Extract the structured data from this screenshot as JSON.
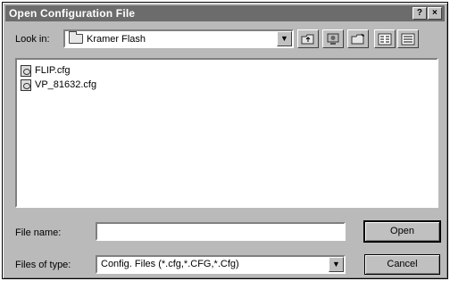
{
  "window": {
    "title": "Open Configuration File",
    "help_label": "?",
    "close_label": "×"
  },
  "lookin": {
    "label": "Look in:",
    "value": "Kramer Flash"
  },
  "toolbar": {
    "icons": [
      "up-folder-icon",
      "desktop-icon",
      "new-folder-icon",
      "list-view-icon",
      "details-view-icon"
    ]
  },
  "files": [
    {
      "name": "FLIP.cfg"
    },
    {
      "name": "VP_81632.cfg"
    }
  ],
  "filename": {
    "label": "File name:",
    "value": ""
  },
  "filetype": {
    "label": "Files of type:",
    "value": "Config. Files (*.cfg,*.CFG,*.Cfg)"
  },
  "buttons": {
    "open_label": "Open",
    "cancel_label": "Cancel"
  }
}
